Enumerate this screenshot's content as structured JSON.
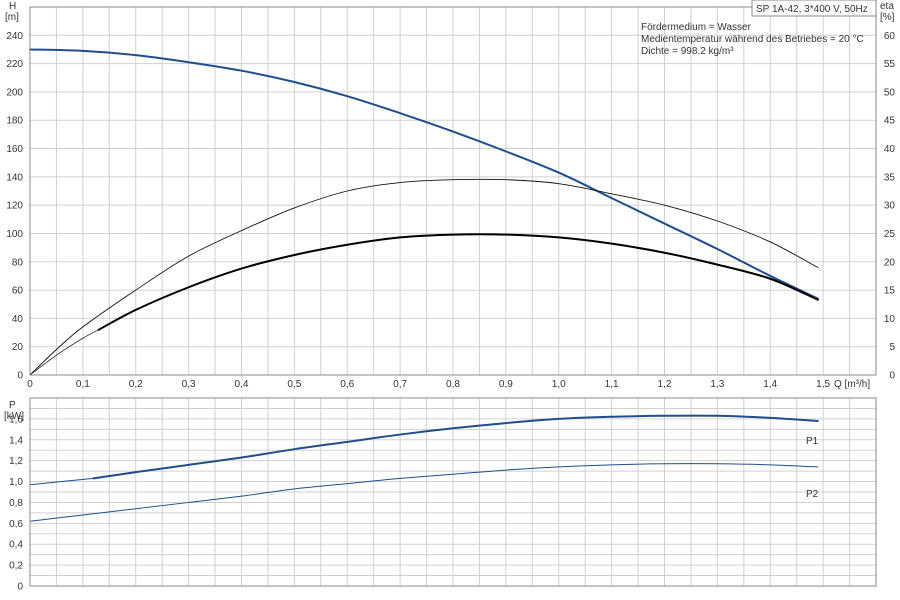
{
  "chart_data": [
    {
      "type": "line",
      "title": "SP 1A-42, 3*400 V, 50Hz",
      "notes": [
        "Fördermedium = Wasser",
        "Medientemperatur während des Betriebes = 20 °C",
        "Dichte = 998.2 kg/m³"
      ],
      "xlabel": "Q [m³/h]",
      "ylabel_left_name": "H",
      "ylabel_left_unit": "[m]",
      "ylabel_right_name": "eta",
      "ylabel_right_unit": "[%]",
      "xlim": [
        0,
        1.6
      ],
      "ylim_left": [
        0,
        260
      ],
      "ylim_right": [
        0,
        65
      ],
      "x_ticks": [
        "0",
        "0,1",
        "0,2",
        "0,3",
        "0,4",
        "0,5",
        "0,6",
        "0,7",
        "0,8",
        "0,9",
        "1,0",
        "1,1",
        "1,2",
        "1,3",
        "1,4",
        "1,5"
      ],
      "y_left_ticks": [
        "0",
        "20",
        "40",
        "60",
        "80",
        "100",
        "120",
        "140",
        "160",
        "180",
        "200",
        "220",
        "240"
      ],
      "y_right_ticks": [
        "0",
        "5",
        "10",
        "15",
        "20",
        "25",
        "30",
        "35",
        "40",
        "45",
        "50",
        "55",
        "60"
      ],
      "grid": true,
      "series": [
        {
          "axis": "left",
          "color": "#1f4e8c",
          "width": 2,
          "x": [
            0,
            0.1,
            0.2,
            0.3,
            0.4,
            0.5,
            0.6,
            0.7,
            0.8,
            0.9,
            1.0,
            1.1,
            1.2,
            1.3,
            1.4,
            1.49
          ],
          "values": [
            230,
            229,
            226,
            221,
            215,
            207,
            197,
            185,
            172,
            158,
            143,
            125,
            107,
            89,
            70,
            54
          ]
        },
        {
          "axis": "right",
          "color": "#111111",
          "width": 0.9,
          "x": [
            0,
            0.05,
            0.1,
            0.2,
            0.3,
            0.4,
            0.5,
            0.6,
            0.7,
            0.8,
            0.9,
            1.0,
            1.1,
            1.2,
            1.3,
            1.4,
            1.49
          ],
          "values": [
            0,
            4.5,
            8.5,
            15,
            21,
            25.5,
            29.5,
            32.5,
            34,
            34.5,
            34.5,
            33.8,
            32,
            30,
            27.2,
            23.5,
            19
          ]
        },
        {
          "axis": "right",
          "color": "#111111",
          "width": 0.7,
          "x": [
            0,
            0.05,
            0.1,
            0.13
          ],
          "values": [
            0,
            3.5,
            6.5,
            8
          ]
        },
        {
          "axis": "right",
          "color": "#000000",
          "width": 2,
          "x": [
            0.13,
            0.2,
            0.3,
            0.4,
            0.5,
            0.6,
            0.7,
            0.8,
            0.9,
            1.0,
            1.1,
            1.2,
            1.3,
            1.4,
            1.49
          ],
          "values": [
            8,
            11.5,
            15.5,
            18.8,
            21.2,
            23,
            24.3,
            24.8,
            24.8,
            24.3,
            23.2,
            21.6,
            19.5,
            17,
            13.3
          ]
        }
      ]
    },
    {
      "type": "line",
      "ylabel_name": "P",
      "ylabel_unit": "[kW]",
      "xlim": [
        0,
        1.6
      ],
      "ylim": [
        0,
        1.8
      ],
      "y_ticks": [
        "0",
        "0,2",
        "0,4",
        "0,6",
        "0,8",
        "1,0",
        "1,2",
        "1,4",
        "1,6"
      ],
      "grid": true,
      "series": [
        {
          "name": "P1",
          "color": "#1f4e8c",
          "width": 2,
          "x": [
            0.12,
            0.2,
            0.3,
            0.4,
            0.5,
            0.6,
            0.7,
            0.8,
            0.9,
            1.0,
            1.1,
            1.2,
            1.3,
            1.4,
            1.49
          ],
          "values": [
            1.03,
            1.09,
            1.16,
            1.23,
            1.31,
            1.38,
            1.45,
            1.51,
            1.56,
            1.6,
            1.62,
            1.63,
            1.63,
            1.61,
            1.58
          ]
        },
        {
          "name": "",
          "color": "#1f4e8c",
          "width": 1,
          "x": [
            0,
            0.06,
            0.12
          ],
          "values": [
            0.97,
            1.0,
            1.03
          ]
        },
        {
          "name": "P2",
          "color": "#1f4e8c",
          "width": 1,
          "x": [
            0,
            0.1,
            0.2,
            0.3,
            0.4,
            0.5,
            0.6,
            0.7,
            0.8,
            0.9,
            1.0,
            1.1,
            1.2,
            1.3,
            1.4,
            1.49
          ],
          "values": [
            0.62,
            0.68,
            0.74,
            0.8,
            0.86,
            0.93,
            0.98,
            1.03,
            1.07,
            1.11,
            1.14,
            1.16,
            1.17,
            1.17,
            1.16,
            1.14
          ]
        }
      ]
    }
  ]
}
